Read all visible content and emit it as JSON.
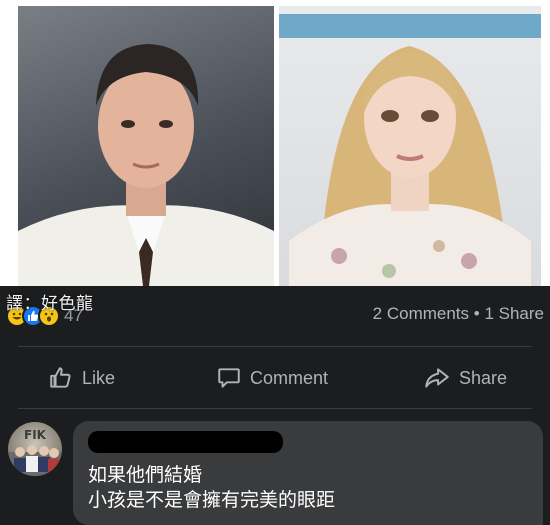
{
  "watermark": "譯：好色龍",
  "reactions": {
    "icons": [
      "haha-icon",
      "like-icon",
      "wow-icon"
    ],
    "count": "47"
  },
  "post_stats": {
    "comments": "2 Comments",
    "separator": "•",
    "shares": "1 Share"
  },
  "actions": {
    "like_label": "Like",
    "comment_label": "Comment",
    "share_label": "Share"
  },
  "comment": {
    "line1": "如果他們結婚",
    "line2": "小孩是不是會擁有完美的眼距"
  },
  "colors": {
    "panel_bg": "#1c1d1f",
    "bubble_bg": "#3a3b3d",
    "muted_text": "#b0b3b8",
    "like_blue": "#1877f2",
    "reaction_yellow": "#f5c518"
  }
}
